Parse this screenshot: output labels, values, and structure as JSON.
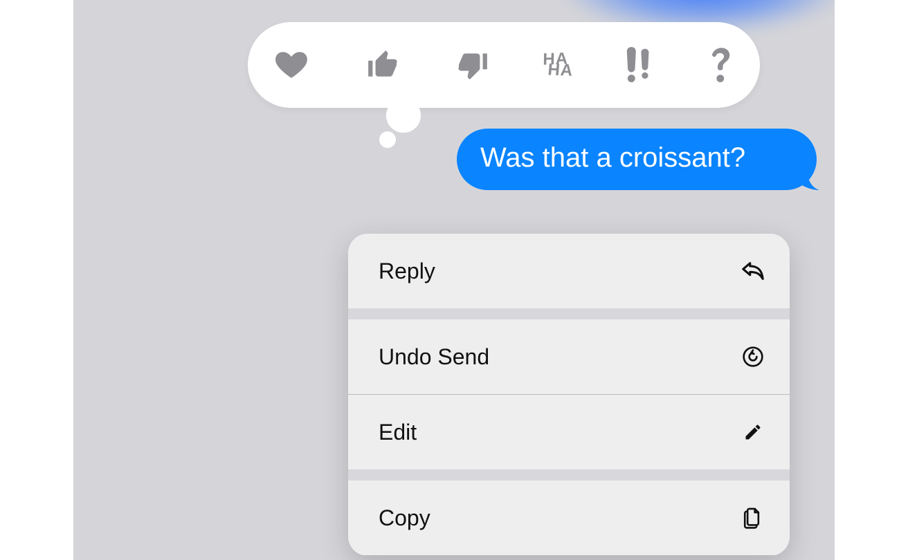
{
  "message": {
    "text": "Was that a croissant?"
  },
  "tapback": {
    "reactions": [
      {
        "name": "heart",
        "label": "Love"
      },
      {
        "name": "thumbs-up",
        "label": "Like"
      },
      {
        "name": "thumbs-down",
        "label": "Dislike"
      },
      {
        "name": "haha",
        "label": "Laugh"
      },
      {
        "name": "exclaim",
        "label": "Emphasize"
      },
      {
        "name": "question",
        "label": "Question"
      }
    ]
  },
  "menu": {
    "reply": "Reply",
    "undo_send": "Undo Send",
    "edit": "Edit",
    "copy": "Copy"
  },
  "colors": {
    "bubble": "#0a84ff",
    "tapback_icon": "#8e8e93"
  }
}
